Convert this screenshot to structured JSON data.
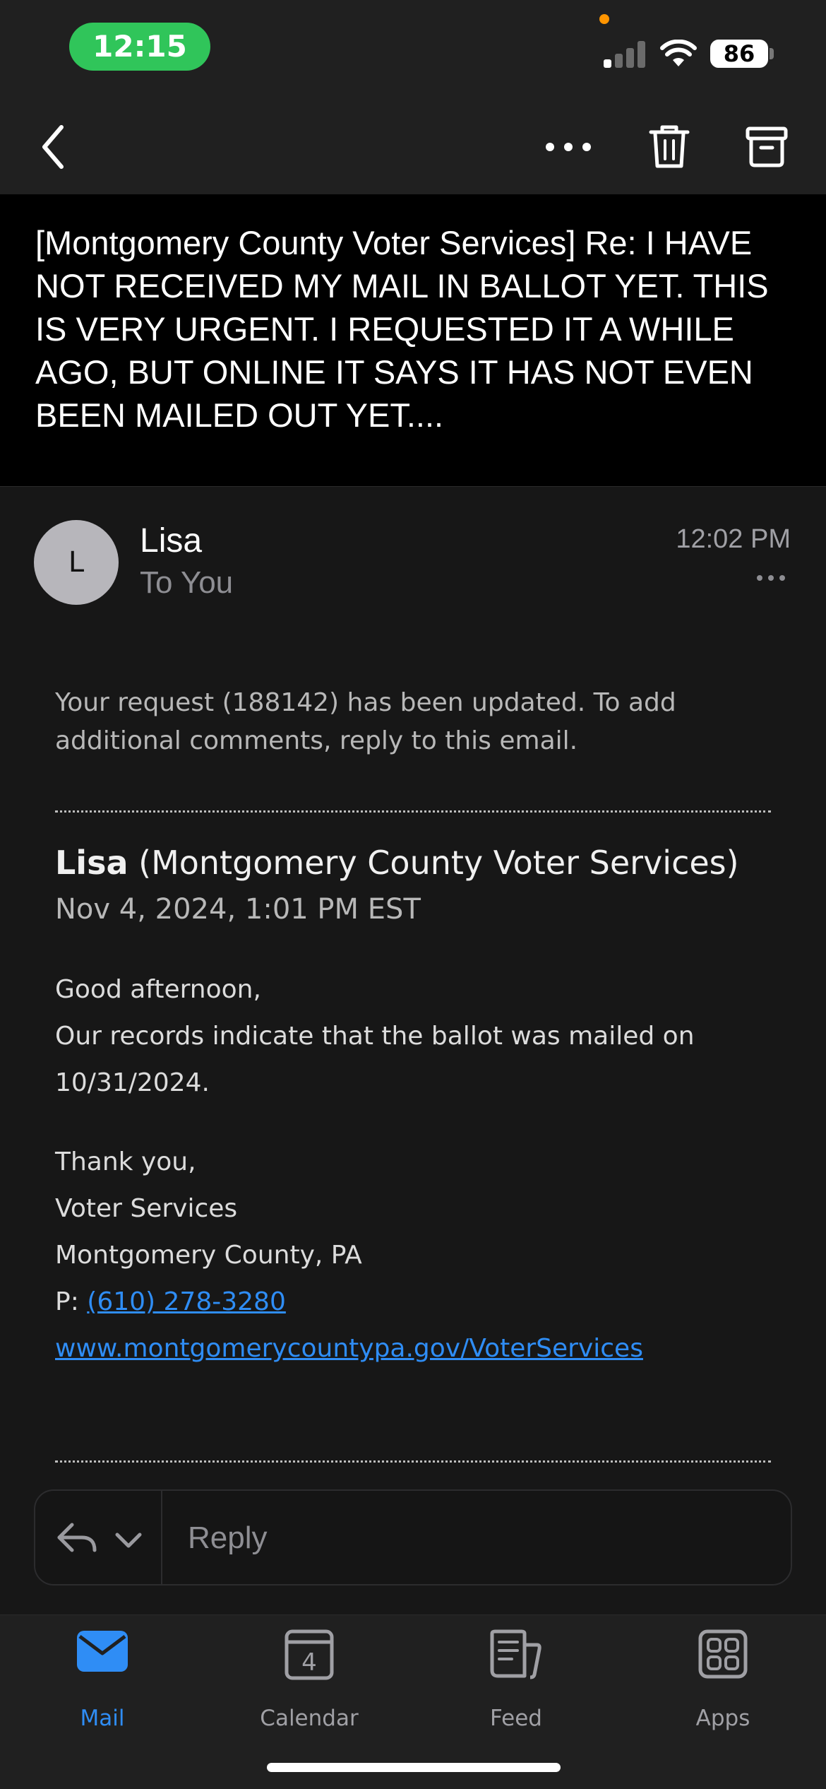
{
  "status_bar": {
    "time": "12:15",
    "battery": "86"
  },
  "subject": "[Montgomery County Voter Services] Re: I HAVE NOT RECEIVED MY MAIL IN BALLOT YET. THIS IS VERY URGENT. I REQUESTED IT A WHILE AGO, BUT ONLINE IT SAYS IT HAS NOT EVEN BEEN MAILED OUT YET....",
  "message": {
    "avatar_initial": "L",
    "sender": "Lisa",
    "recipient": "To You",
    "time": "12:02 PM",
    "notice": "Your request (188142) has been updated. To add additional comments, reply to this email.",
    "reply_author_name": "Lisa",
    "reply_author_org": "(Montgomery County Voter Services)",
    "reply_date": "Nov 4, 2024, 1:01 PM EST",
    "greeting": "Good afternoon,",
    "body_line1": "Our records indicate that the ballot was mailed on",
    "body_line2": "10/31/2024.",
    "signoff": "Thank you,",
    "sig_name": "Voter Services",
    "sig_location": "Montgomery County, PA",
    "phone_prefix": "P: ",
    "phone": "(610) 278-3280",
    "website": "www.montgomerycountypa.gov/VoterServices"
  },
  "reply_bar": {
    "placeholder": "Reply"
  },
  "tabs": [
    {
      "label": "Mail",
      "icon": "mail-icon",
      "active": true
    },
    {
      "label": "Calendar",
      "icon": "calendar-icon",
      "calendar_day": "4"
    },
    {
      "label": "Feed",
      "icon": "feed-icon"
    },
    {
      "label": "Apps",
      "icon": "apps-icon"
    }
  ],
  "colors": {
    "accent": "#2f8df5",
    "time_pill": "#30c55a",
    "background": "#171717"
  }
}
